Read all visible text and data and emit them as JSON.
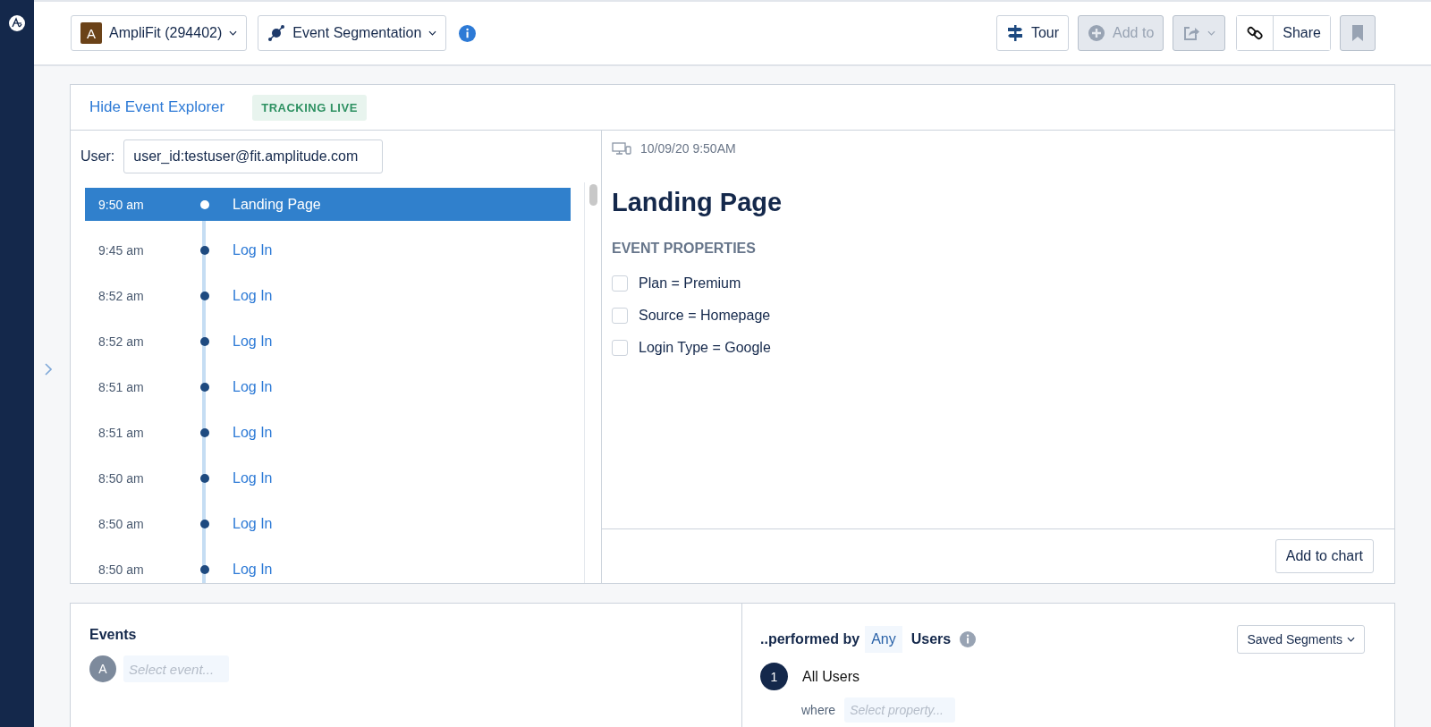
{
  "header": {
    "project": {
      "avatar": "A",
      "label": "AmpliFit (294402)"
    },
    "chart_type": "Event Segmentation",
    "toolbar": [
      {
        "kind": "tour",
        "label": "Tour",
        "disabled": false
      },
      {
        "kind": "add",
        "label": "Add to",
        "disabled": true
      },
      {
        "kind": "export",
        "disabled": true
      },
      {
        "kind": "share",
        "label": "Share",
        "disabled": false
      },
      {
        "kind": "bookmark",
        "disabled": true
      }
    ]
  },
  "explorer": {
    "hide_link": "Hide Event Explorer",
    "status_badge": "TRACKING LIVE",
    "user_label": "User:",
    "user_value": "user_id:testuser@fit.amplitude.com",
    "events": [
      {
        "time": "9:50 am",
        "name": "Landing Page",
        "selected": true
      },
      {
        "time": "9:45 am",
        "name": "Log In",
        "selected": false
      },
      {
        "time": "8:52 am",
        "name": "Log In",
        "selected": false
      },
      {
        "time": "8:52 am",
        "name": "Log In",
        "selected": false
      },
      {
        "time": "8:51 am",
        "name": "Log In",
        "selected": false
      },
      {
        "time": "8:51 am",
        "name": "Log In",
        "selected": false
      },
      {
        "time": "8:50 am",
        "name": "Log In",
        "selected": false
      },
      {
        "time": "8:50 am",
        "name": "Log In",
        "selected": false
      },
      {
        "time": "8:50 am",
        "name": "Log In",
        "selected": false
      }
    ],
    "detail": {
      "timestamp": "10/09/20 9:50AM",
      "title": "Landing Page",
      "section": "EVENT PROPERTIES",
      "properties": [
        {
          "label": "Plan = Premium",
          "checked": false
        },
        {
          "label": "Source = Homepage",
          "checked": false
        },
        {
          "label": "Login Type = Google",
          "checked": false
        }
      ],
      "add_button": "Add to chart"
    }
  },
  "events_panel": {
    "title": "Events",
    "avatar": "A",
    "placeholder": "Select event..."
  },
  "users_panel": {
    "prefix": "..performed by",
    "any": "Any",
    "suffix": "Users",
    "saved_button": "Saved Segments",
    "segments": [
      {
        "number": "1",
        "name": "All Users",
        "where": "where",
        "placeholder": "Select property..."
      }
    ]
  }
}
